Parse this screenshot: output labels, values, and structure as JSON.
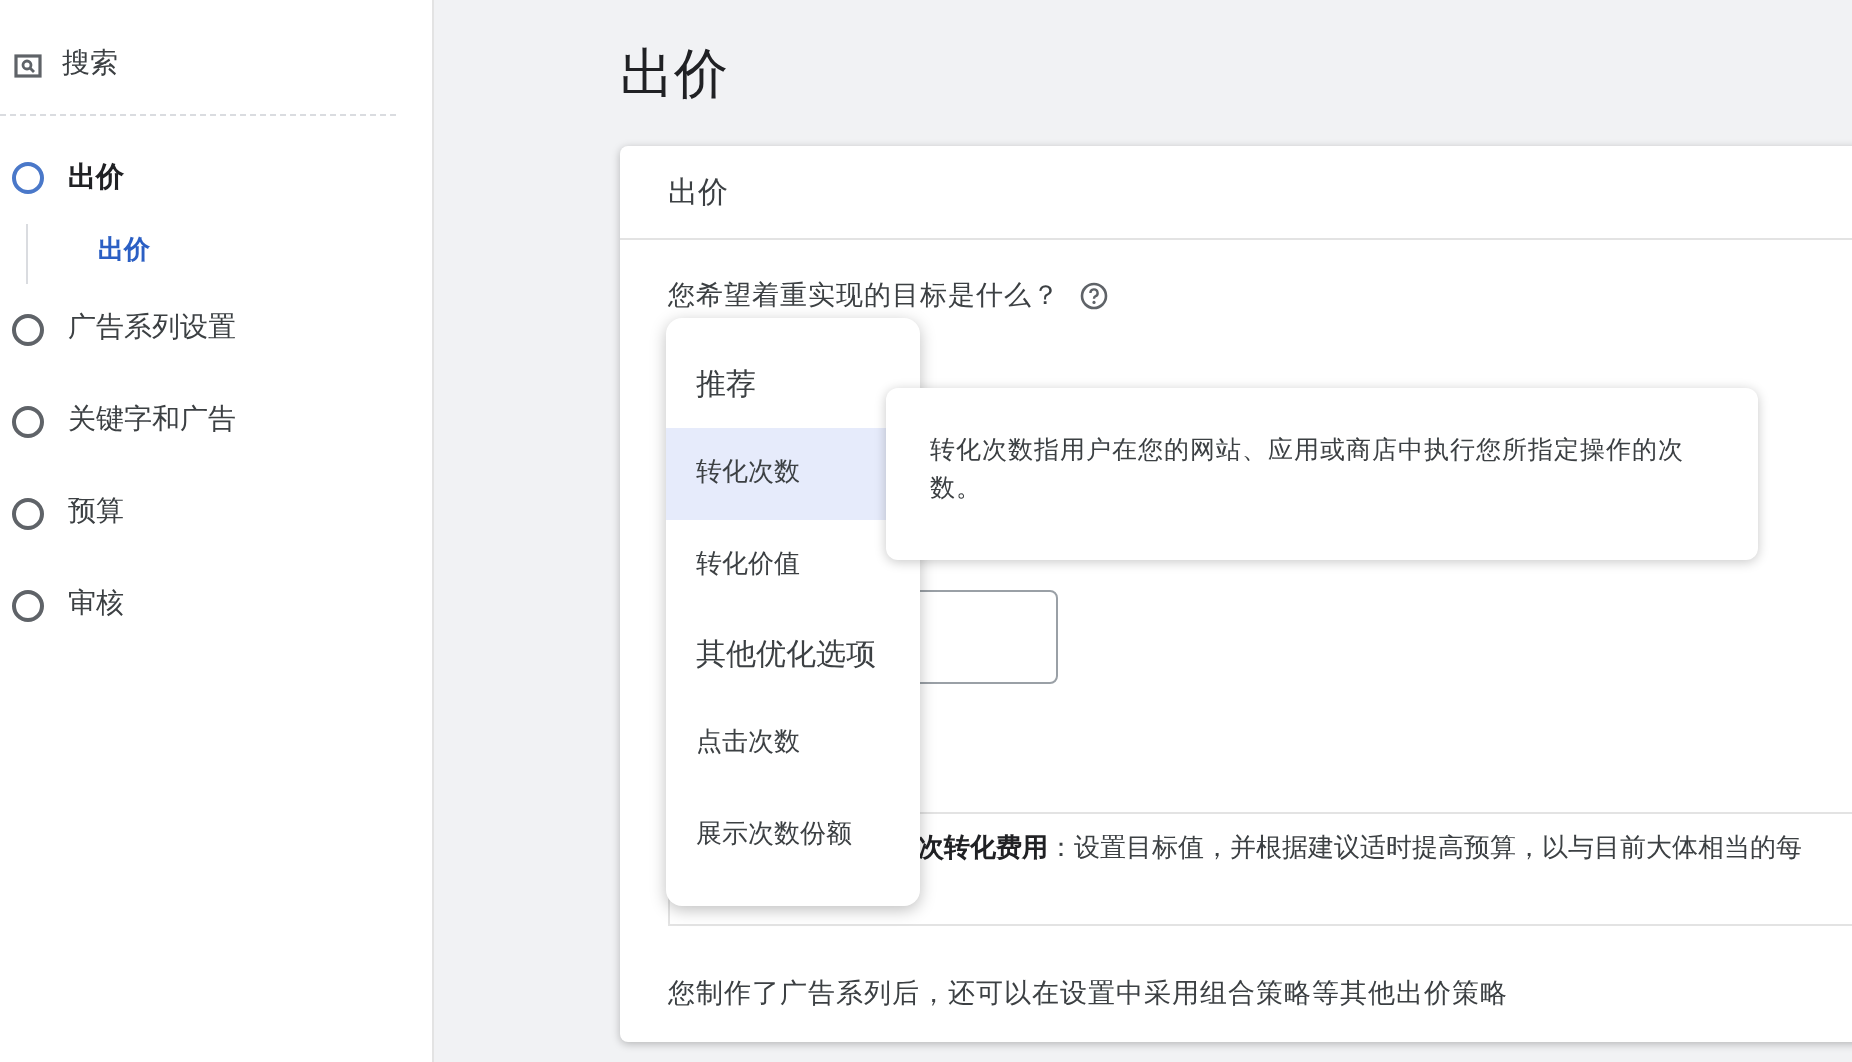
{
  "sidebar": {
    "search": {
      "label": "搜索"
    },
    "steps": [
      {
        "label": "出价",
        "selected": true,
        "children": [
          {
            "label": "出价",
            "selected": true
          }
        ]
      },
      {
        "label": "广告系列设置",
        "selected": false
      },
      {
        "label": "关键字和广告",
        "selected": false
      },
      {
        "label": "预算",
        "selected": false
      },
      {
        "label": "审核",
        "selected": false
      }
    ]
  },
  "page_title": "出价",
  "card": {
    "title": "出价",
    "question": "您希望着重实现的目标是什么？",
    "strategy_text": "**次转化费用**：设置目标值，并根据建议适时提高预算，以与目前大体相当的每",
    "footer": "您制作了广告系列后，还可以在设置中采用组合策略等其他出价策略"
  },
  "dropdown": {
    "options": [
      {
        "label": "推荐",
        "kind": "group"
      },
      {
        "label": "转化次数",
        "kind": "option",
        "selected": true
      },
      {
        "label": "转化价值",
        "kind": "option",
        "selected": false
      },
      {
        "label": "其他优化选项",
        "kind": "group"
      },
      {
        "label": "点击次数",
        "kind": "option",
        "selected": false
      },
      {
        "label": "展示次数份额",
        "kind": "option",
        "selected": false
      }
    ]
  },
  "tooltip": {
    "text": "转化次数指用户在您的网站、应用或商店中执行您所指定操作的次数。"
  }
}
